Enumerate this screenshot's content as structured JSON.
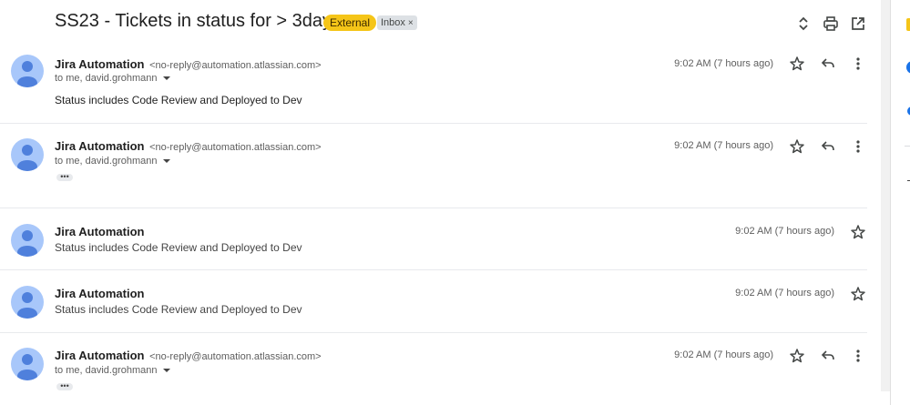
{
  "subject": "SS23 - Tickets in status for > 3days",
  "labels": {
    "external": "External",
    "inbox": "Inbox",
    "inbox_remove": "×"
  },
  "toolbar": {
    "expand_icon": "unfold-icon",
    "print_icon": "print-icon",
    "open_icon": "open-in-new-icon"
  },
  "messages": [
    {
      "sender": "Jira Automation",
      "email": "<no-reply@automation.atlassian.com>",
      "to": "to me, david.grohmann",
      "time": "9:02 AM (7 hours ago)",
      "body": "Status includes Code Review and Deployed to Dev"
    },
    {
      "sender": "Jira Automation",
      "email": "<no-reply@automation.atlassian.com>",
      "to": "to me, david.grohmann",
      "time": "9:02 AM (7 hours ago)",
      "trimmed": "•••"
    },
    {
      "sender": "Jira Automation",
      "time": "9:02 AM (7 hours ago)",
      "snippet": "Status includes Code Review and Deployed to Dev"
    },
    {
      "sender": "Jira Automation",
      "time": "9:02 AM (7 hours ago)",
      "snippet": "Status includes Code Review and Deployed to Dev"
    },
    {
      "sender": "Jira Automation",
      "email": "<no-reply@automation.atlassian.com>",
      "to": "to me, david.grohmann",
      "time": "9:02 AM (7 hours ago)",
      "trimmed": "•••"
    }
  ],
  "colors": {
    "external_badge": "#f5c518",
    "avatar": "#a8c7fa",
    "avatar_figure": "#4f80dc"
  }
}
